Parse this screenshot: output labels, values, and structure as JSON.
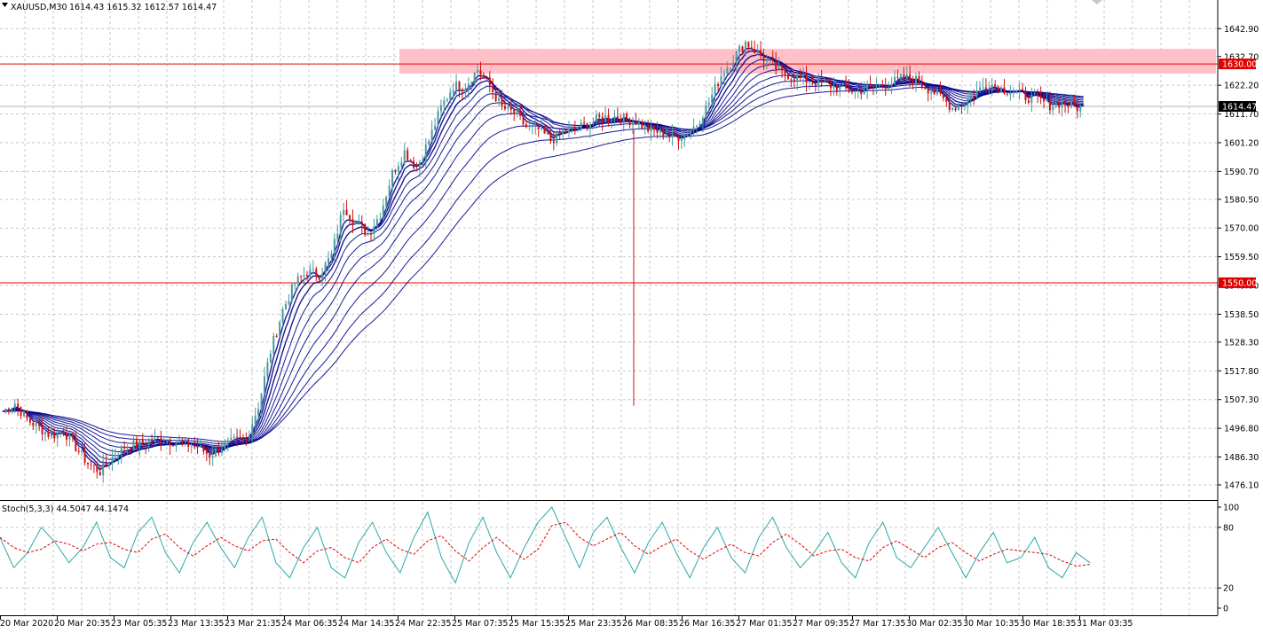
{
  "header": {
    "symbol": "XAUUSD,M30",
    "ohlc": "1614.43 1615.32 1612.57 1614.47"
  },
  "indicator": {
    "label": "Stoch(5,3,3) 44.5047 44.1474",
    "levels": [
      "100",
      "80",
      "20",
      "0"
    ]
  },
  "colors": {
    "bull": "#4a9aa0",
    "bear": "#d01010",
    "ma": "#00008b",
    "zone": "#ffc0c8",
    "hline": "#e00000",
    "stoch_main": "#2aa8a8",
    "stoch_signal": "#e00000",
    "price_badge": "#000000"
  },
  "chart_data": {
    "type": "candlestick",
    "price_axis_ticks": [
      "1642.90",
      "1632.70",
      "1622.20",
      "1611.70",
      "1601.20",
      "1590.70",
      "1580.50",
      "1570.00",
      "1559.50",
      "1549.00",
      "1538.50",
      "1528.30",
      "1517.80",
      "1507.30",
      "1496.80",
      "1486.30",
      "1476.10"
    ],
    "time_axis_labels": [
      "20 Mar 2020",
      "20 Mar 20:35",
      "23 Mar 05:35",
      "23 Mar 13:35",
      "23 Mar 21:35",
      "24 Mar 06:35",
      "24 Mar 14:35",
      "24 Mar 22:35",
      "25 Mar 07:35",
      "25 Mar 15:35",
      "25 Mar 23:35",
      "26 Mar 08:35",
      "26 Mar 16:35",
      "27 Mar 01:35",
      "27 Mar 09:35",
      "27 Mar 17:35",
      "30 Mar 02:35",
      "30 Mar 10:35",
      "30 Mar 18:35",
      "31 Mar 03:35"
    ],
    "ylim": [
      1473.5,
      1648.5
    ],
    "horizontal_lines": [
      {
        "price": 1630.0,
        "label": "1630.00"
      },
      {
        "price": 1550.0,
        "label": "1550.00"
      }
    ],
    "current_price": {
      "price": 1614.47,
      "label": "1614.47"
    },
    "resistance_zone": [
      1626.5,
      1635.5
    ],
    "close_path": [
      [
        0,
        1503
      ],
      [
        4,
        1506
      ],
      [
        8,
        1500
      ],
      [
        12,
        1497
      ],
      [
        16,
        1494
      ],
      [
        20,
        1496
      ],
      [
        24,
        1490
      ],
      [
        28,
        1484
      ],
      [
        32,
        1481
      ],
      [
        36,
        1486
      ],
      [
        40,
        1490
      ],
      [
        44,
        1491
      ],
      [
        48,
        1492
      ],
      [
        52,
        1493
      ],
      [
        56,
        1492
      ],
      [
        60,
        1491
      ],
      [
        64,
        1490
      ],
      [
        68,
        1487
      ],
      [
        72,
        1490
      ],
      [
        76,
        1492
      ],
      [
        80,
        1493
      ],
      [
        84,
        1505
      ],
      [
        88,
        1525
      ],
      [
        92,
        1540
      ],
      [
        96,
        1550
      ],
      [
        100,
        1554
      ],
      [
        104,
        1553
      ],
      [
        108,
        1560
      ],
      [
        112,
        1578
      ],
      [
        116,
        1572
      ],
      [
        120,
        1568
      ],
      [
        124,
        1575
      ],
      [
        128,
        1590
      ],
      [
        132,
        1598
      ],
      [
        136,
        1592
      ],
      [
        140,
        1602
      ],
      [
        144,
        1614
      ],
      [
        148,
        1622
      ],
      [
        152,
        1622
      ],
      [
        156,
        1628
      ],
      [
        160,
        1622
      ],
      [
        164,
        1614
      ],
      [
        168,
        1612
      ],
      [
        172,
        1607
      ],
      [
        176,
        1606
      ],
      [
        180,
        1602
      ],
      [
        184,
        1605
      ],
      [
        188,
        1606
      ],
      [
        192,
        1608
      ],
      [
        196,
        1610
      ],
      [
        200,
        1611
      ],
      [
        204,
        1610
      ],
      [
        208,
        1609
      ],
      [
        212,
        1606
      ],
      [
        216,
        1605
      ],
      [
        220,
        1603
      ],
      [
        224,
        1604
      ],
      [
        228,
        1608
      ],
      [
        232,
        1616
      ],
      [
        236,
        1626
      ],
      [
        240,
        1632
      ],
      [
        244,
        1638
      ],
      [
        248,
        1634
      ],
      [
        252,
        1630
      ],
      [
        256,
        1627
      ],
      [
        260,
        1625
      ],
      [
        264,
        1624
      ],
      [
        268,
        1623
      ],
      [
        272,
        1622
      ],
      [
        276,
        1621
      ],
      [
        280,
        1620
      ],
      [
        284,
        1621
      ],
      [
        288,
        1622
      ],
      [
        292,
        1623
      ],
      [
        296,
        1625
      ],
      [
        300,
        1624
      ],
      [
        304,
        1621
      ],
      [
        308,
        1618
      ],
      [
        312,
        1614
      ],
      [
        316,
        1616
      ],
      [
        320,
        1620
      ],
      [
        324,
        1623
      ],
      [
        328,
        1621
      ],
      [
        332,
        1620
      ],
      [
        336,
        1618
      ],
      [
        340,
        1617
      ],
      [
        344,
        1615
      ],
      [
        348,
        1616
      ],
      [
        352,
        1614
      ],
      [
        356,
        1614.47
      ]
    ],
    "stoch": {
      "main": [
        70,
        40,
        55,
        80,
        65,
        45,
        60,
        85,
        50,
        40,
        75,
        90,
        55,
        35,
        65,
        85,
        60,
        40,
        70,
        90,
        45,
        30,
        60,
        80,
        40,
        30,
        65,
        85,
        55,
        35,
        70,
        95,
        50,
        25,
        65,
        90,
        55,
        30,
        60,
        85,
        100,
        70,
        40,
        75,
        90,
        60,
        35,
        65,
        85,
        55,
        30,
        60,
        80,
        50,
        35,
        70,
        90,
        60,
        40,
        55,
        75,
        45,
        30,
        65,
        85,
        50,
        40,
        60,
        80,
        55,
        30,
        55,
        75,
        45,
        50,
        70,
        40,
        30,
        55,
        45
      ],
      "levels": [
        100,
        80,
        20,
        0
      ]
    }
  }
}
